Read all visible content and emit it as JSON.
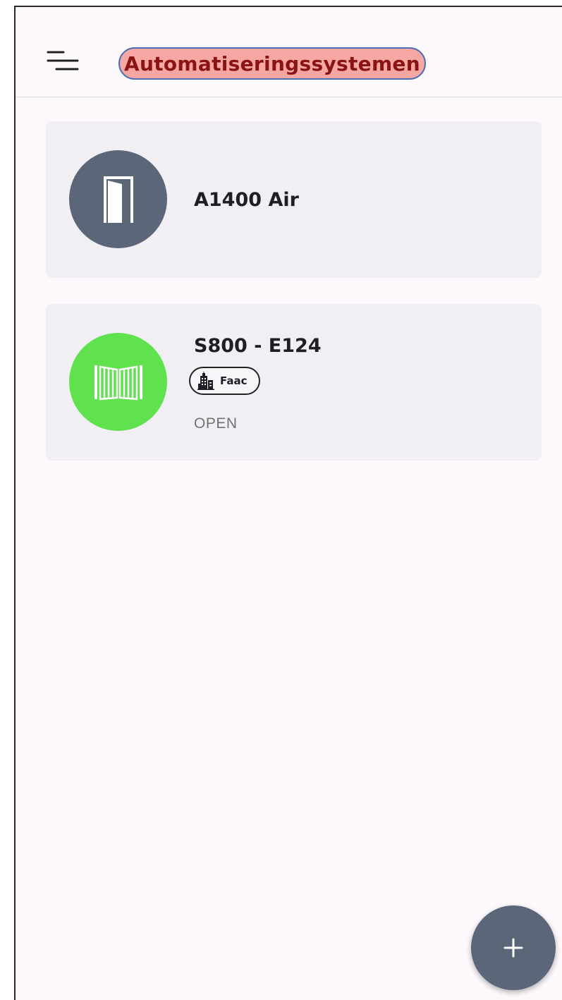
{
  "header": {
    "title": "Automatiseringssystemen",
    "menu_icon": "menu-lines-icon"
  },
  "devices": [
    {
      "name": "A1400 Air",
      "icon": "door-icon",
      "avatar_color": "#5b6679"
    },
    {
      "name": "S800 - E124",
      "icon": "folding-gate-icon",
      "avatar_color": "#5fe24d",
      "brand": "Faac",
      "brand_icon": "building-icon",
      "status": "OPEN"
    }
  ],
  "fab": {
    "icon": "plus-icon",
    "color": "#5b6679"
  },
  "colors": {
    "background": "#fcf8fc",
    "card": "#f1eff3",
    "title_highlight": "#f6a7a3",
    "title_text": "#8a1414"
  }
}
